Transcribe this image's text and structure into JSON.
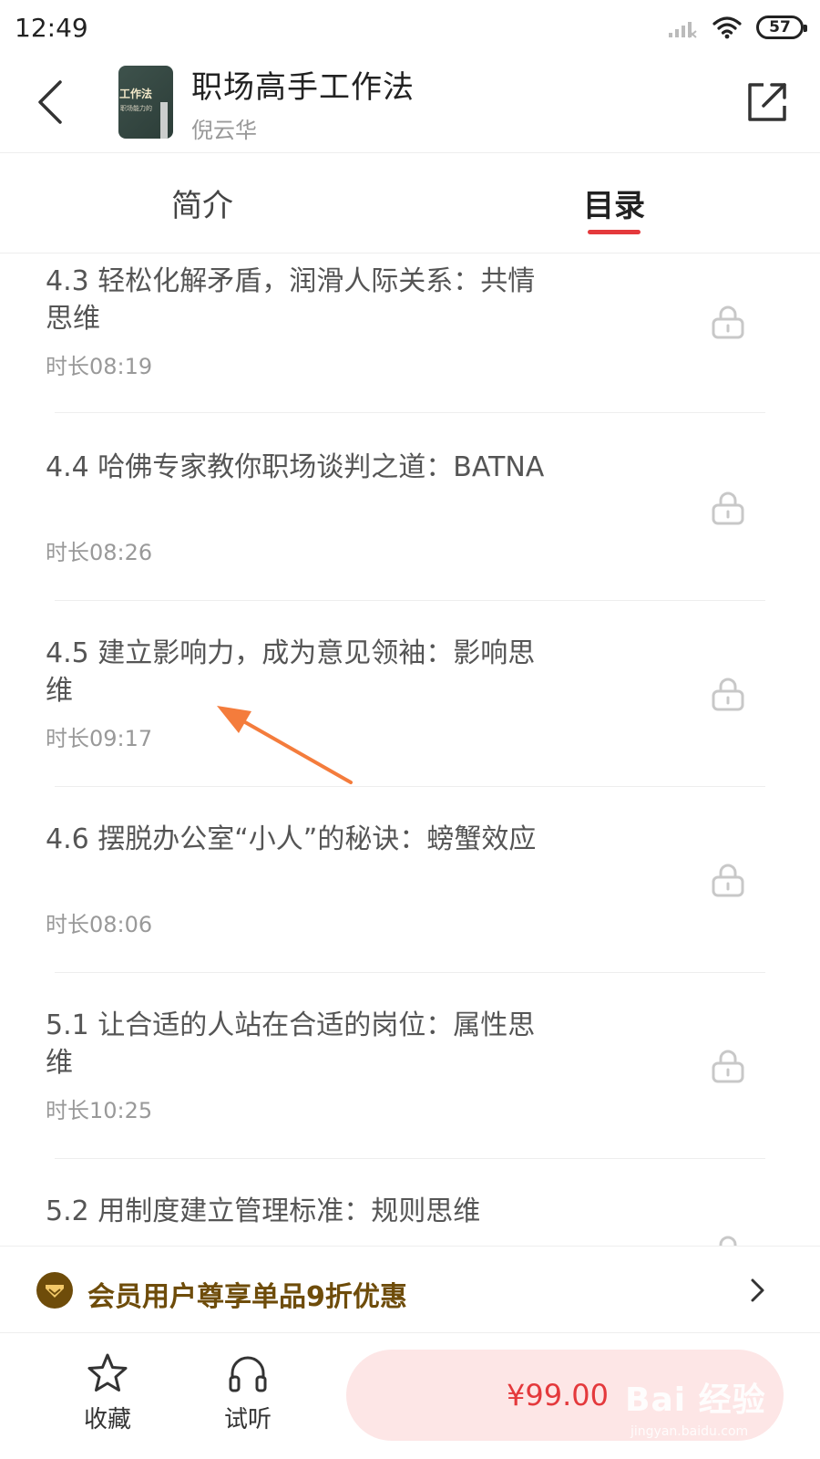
{
  "status_bar": {
    "time": "12:49",
    "battery": "57"
  },
  "header": {
    "title": "职场高手工作法",
    "author": "倪云华",
    "cover": {
      "line1": "工作法",
      "line2": "职场能力的"
    }
  },
  "tabs": [
    {
      "label": "简介",
      "active": false
    },
    {
      "label": "目录",
      "active": true
    }
  ],
  "chapters": [
    {
      "title": "4.3 轻松化解矛盾，润滑人际关系：共情思维",
      "duration": "时长08:19",
      "locked": true
    },
    {
      "title": "4.4 哈佛专家教你职场谈判之道：BATNA",
      "duration": "时长08:26",
      "locked": true
    },
    {
      "title": "4.5  建立影响力，成为意见领袖：影响思维",
      "duration": "时长09:17",
      "locked": true
    },
    {
      "title": "4.6 摆脱办公室“小人”的秘诀：螃蟹效应",
      "duration": "时长08:06",
      "locked": true
    },
    {
      "title": "5.1 让合适的人站在合适的岗位：属性思维",
      "duration": "时长10:25",
      "locked": true
    },
    {
      "title": "5.2 用制度建立管理标准：规则思维",
      "duration": "",
      "locked": true
    }
  ],
  "promo": {
    "text": "会员用户尊享单品9折优惠"
  },
  "bottom_bar": {
    "favorite_label": "收藏",
    "listen_label": "试听",
    "price_label": "¥99.00"
  },
  "watermark": {
    "text": "Bai 经验",
    "url": "jingyan.baidu.com"
  },
  "colors": {
    "accent": "#e4393c",
    "promo": "#6e4c0a",
    "price_bg": "#fde6e6",
    "arrow": "#f47c3c"
  },
  "icons": [
    "back-arrow-icon",
    "share-icon",
    "lock-icon",
    "crown-badge-icon",
    "chevron-right-icon",
    "star-icon",
    "headphones-icon",
    "signal-icon",
    "wifi-icon"
  ]
}
